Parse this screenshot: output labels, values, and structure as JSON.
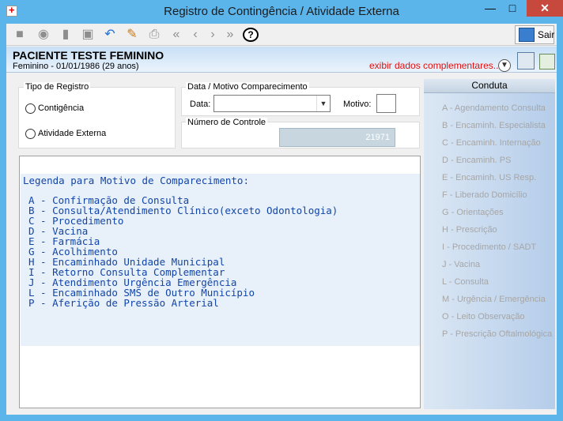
{
  "window": {
    "title": "Registro de Contingência / Atividade Externa"
  },
  "toolbar": {
    "sair_label": "Sair",
    "icons": [
      "new-icon",
      "search-icon",
      "eraser-icon",
      "trash-icon",
      "undo-icon",
      "edit-icon",
      "print-icon",
      "first-icon",
      "prev-icon",
      "next-icon",
      "last-icon",
      "help-icon"
    ],
    "help_glyph": "?"
  },
  "patient": {
    "name": "PACIENTE TESTE FEMININO",
    "info": "Feminino - 01/01/1986 (29 anos)",
    "extra_link": "exibir dados complementares..."
  },
  "tipo_registro": {
    "label": "Tipo de Registro",
    "options": [
      "Contigência",
      "Atividade Externa"
    ]
  },
  "comparecimento": {
    "label": "Data / Motivo Comparecimento",
    "data_label": "Data:",
    "data_value": "",
    "motivo_label": "Motivo:",
    "motivo_value": ""
  },
  "controle": {
    "label": "Número de Controle",
    "value": "21971"
  },
  "legenda": {
    "title": "Legenda para Motivo de Comparecimento:",
    "items": [
      "A - Confirmação de Consulta",
      "B - Consulta/Atendimento Clínico(exceto Odontologia)",
      "C - Procedimento",
      "D - Vacina",
      "E - Farmácia",
      "G - Acolhimento",
      "H - Encaminhado Unidade Municipal",
      "I - Retorno Consulta Complementar",
      "J - Atendimento Urgência Emergência",
      "L - Encaminhado SMS de Outro Município",
      "P - Aferição de Pressão Arterial"
    ]
  },
  "conduta": {
    "header": "Conduta",
    "items": [
      "A - Agendamento Consulta",
      "B - Encaminh. Especialista",
      "C - Encaminh. Internação",
      "D - Encaminh. PS",
      "E - Encaminh. US Resp.",
      "F - Liberado Domicílio",
      "G - Orientações",
      "H - Prescrição",
      "I - Procedimento / SADT",
      "J - Vacina",
      "L - Consulta",
      "M - Urgência / Emergência",
      "O - Leito Observação",
      "P - Prescrição Oftalmológica"
    ]
  }
}
